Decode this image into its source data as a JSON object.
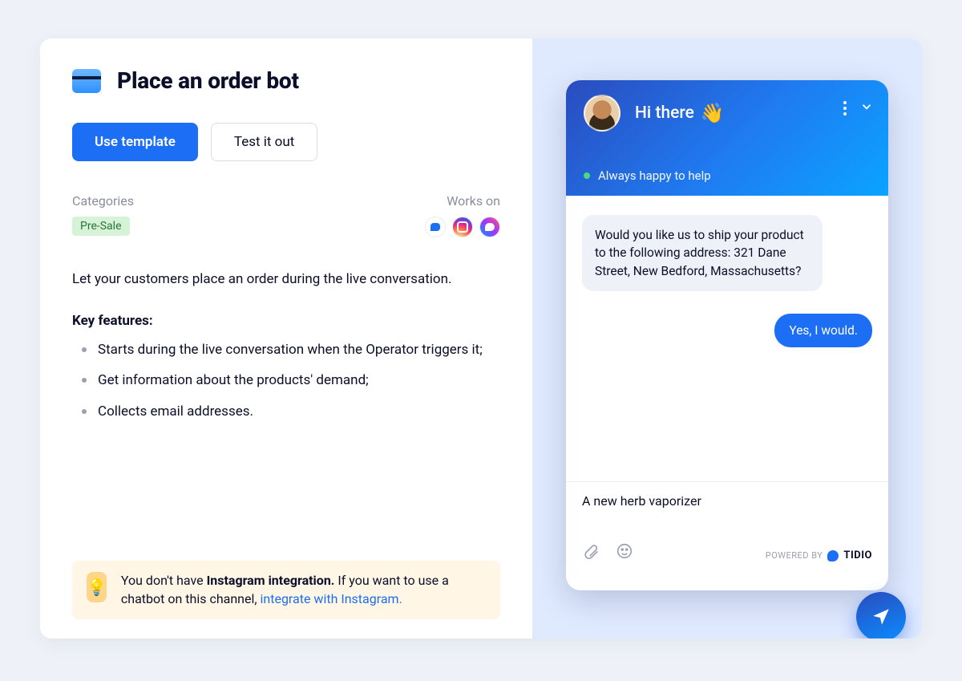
{
  "title": "Place an order bot",
  "actions": {
    "use_template": "Use template",
    "test_it_out": "Test it out"
  },
  "categories_label": "Categories",
  "category_tag": "Pre-Sale",
  "works_on_label": "Works on",
  "channels": [
    "chat",
    "instagram",
    "messenger"
  ],
  "description": "Let your customers place an order during the live conversation.",
  "features_title": "Key features:",
  "features": [
    "Starts during the live conversation when the Operator triggers it;",
    "Get information about the products' demand;",
    "Collects email addresses."
  ],
  "tip": {
    "text_lead": "You don't have ",
    "strong": "Instagram integration.",
    "text_after": " If you want to use a chatbot on this channel, ",
    "link": "integrate with Instagram."
  },
  "chat": {
    "greeting": "Hi there",
    "wave": "👋",
    "status": "Always happy to help",
    "bot_message": "Would you like us to ship your product to the following address: 321 Dane Street, New Bedford, Massachusetts?",
    "user_message": "Yes, I would.",
    "input_value": "A new herb vaporizer",
    "powered_label": "POWERED BY",
    "powered_brand": "TIDIO"
  }
}
